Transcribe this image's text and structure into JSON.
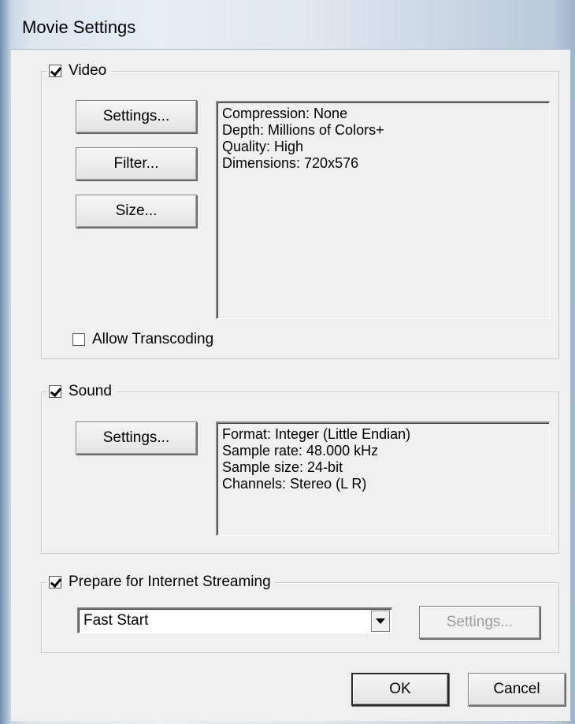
{
  "window": {
    "title": "Movie Settings"
  },
  "video": {
    "label": "Video",
    "checked": true,
    "settings_label": "Settings...",
    "filter_label": "Filter...",
    "size_label": "Size...",
    "info": [
      "Compression: None",
      "Depth: Millions of Colors+",
      "Quality: High",
      "Dimensions: 720x576"
    ],
    "allow_transcoding_label": "Allow Transcoding",
    "allow_transcoding_checked": false
  },
  "sound": {
    "label": "Sound",
    "checked": true,
    "settings_label": "Settings...",
    "info": [
      "Format: Integer (Little Endian)",
      "Sample rate: 48.000 kHz",
      "Sample size: 24-bit",
      "Channels: Stereo (L R)"
    ]
  },
  "streaming": {
    "label": "Prepare for Internet Streaming",
    "checked": true,
    "selected": "Fast Start",
    "settings_label": "Settings..."
  },
  "footer": {
    "ok_label": "OK",
    "cancel_label": "Cancel"
  }
}
